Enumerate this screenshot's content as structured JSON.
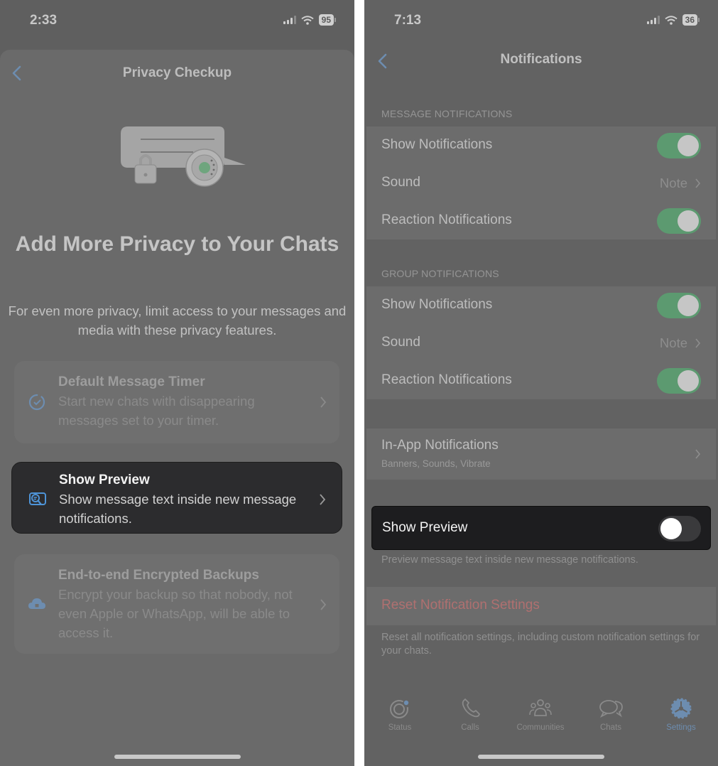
{
  "left_screen": {
    "status_bar": {
      "time": "2:33",
      "battery": "95"
    },
    "nav": {
      "title": "Privacy Checkup",
      "back_icon": "chevron-left-icon"
    },
    "illustration": "privacy-chat-lock-illustration",
    "headline": "Add More Privacy to Your Chats",
    "subtext": "For even more privacy, limit access to your messages and media with these privacy features.",
    "cards": [
      {
        "icon": "timer-icon",
        "title": "Default Message Timer",
        "description": "Start new chats with disappearing messages set to your timer.",
        "highlighted": false
      },
      {
        "icon": "message-preview-icon",
        "title": "Show Preview",
        "description": "Show message text inside new message notifications.",
        "highlighted": true
      },
      {
        "icon": "cloud-lock-icon",
        "title": "End-to-end Encrypted Backups",
        "description": "Encrypt your backup so that nobody, not even Apple or WhatsApp, will be able to access it.",
        "highlighted": false
      }
    ]
  },
  "right_screen": {
    "status_bar": {
      "time": "7:13",
      "battery": "36"
    },
    "nav": {
      "title": "Notifications",
      "back_icon": "chevron-left-icon"
    },
    "message_section": {
      "header": "MESSAGE NOTIFICATIONS",
      "rows": [
        {
          "label": "Show Notifications",
          "type": "toggle",
          "on": true
        },
        {
          "label": "Sound",
          "type": "link",
          "value": "Note"
        },
        {
          "label": "Reaction Notifications",
          "type": "toggle",
          "on": true
        }
      ]
    },
    "group_section": {
      "header": "GROUP NOTIFICATIONS",
      "rows": [
        {
          "label": "Show Notifications",
          "type": "toggle",
          "on": true
        },
        {
          "label": "Sound",
          "type": "link",
          "value": "Note"
        },
        {
          "label": "Reaction Notifications",
          "type": "toggle",
          "on": true
        }
      ]
    },
    "in_app": {
      "label": "In-App Notifications",
      "sublabel": "Banners, Sounds, Vibrate"
    },
    "show_preview": {
      "label": "Show Preview",
      "on": false,
      "footer": "Preview message text inside new message notifications."
    },
    "reset": {
      "label": "Reset Notification Settings",
      "footer": "Reset all notification settings, including custom notification settings for your chats."
    },
    "tab_bar": [
      {
        "label": "Status",
        "icon": "status-icon",
        "active": false
      },
      {
        "label": "Calls",
        "icon": "phone-icon",
        "active": false
      },
      {
        "label": "Communities",
        "icon": "communities-icon",
        "active": false
      },
      {
        "label": "Chats",
        "icon": "chats-icon",
        "active": false
      },
      {
        "label": "Settings",
        "icon": "settings-gear-icon",
        "active": true
      }
    ]
  },
  "colors": {
    "accent_blue": "#6d8db0",
    "toggle_on_green": "#5c9a70",
    "destructive_red": "#b07070",
    "highlight_dark": "#2c2c2e"
  }
}
